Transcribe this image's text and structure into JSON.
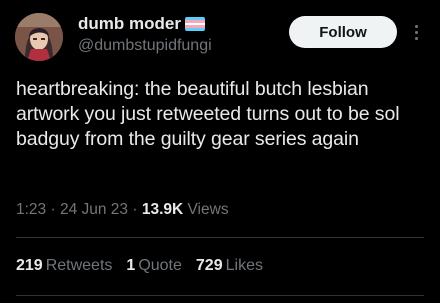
{
  "user": {
    "display_name": "dumb moder",
    "handle": "@dumbstupidfungi",
    "flag_colors": [
      "#5bcefa",
      "#f5a9b8",
      "#ffffff",
      "#f5a9b8",
      "#5bcefa"
    ]
  },
  "header": {
    "follow_label": "Follow",
    "more_icon": "more-vertical-icon"
  },
  "tweet": {
    "text": "heartbreaking: the beautiful butch lesbian artwork you just retweeted turns out to be sol badguy from the guilty gear series again",
    "time": "1:23",
    "date": "24 Jun 23",
    "views_count": "13.9K",
    "views_label": "Views"
  },
  "stats": {
    "retweets_count": "219",
    "retweets_label": "Retweets",
    "quotes_count": "1",
    "quotes_label": "Quote",
    "likes_count": "729",
    "likes_label": "Likes"
  },
  "colors": {
    "background": "#000000",
    "text_primary": "#e7e9ea",
    "text_secondary": "#71767b",
    "divider": "#2f3336",
    "button_bg": "#eff3f4"
  }
}
